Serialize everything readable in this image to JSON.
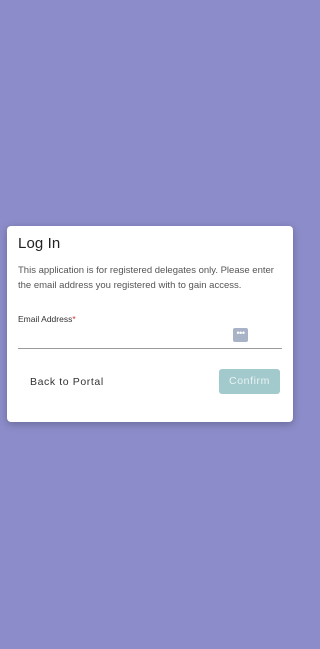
{
  "dialog": {
    "title": "Log In",
    "message": "This application is for registered delegates only. Please enter the email address you registered with to gain access.",
    "email_field": {
      "label": "Email Address",
      "required_marker": "*",
      "value": "",
      "placeholder": ""
    },
    "password_manager_icon": "key-dots-icon",
    "back_label": "Back to Portal",
    "confirm_label": "Confirm",
    "confirm_disabled": true
  },
  "colors": {
    "background": "#8b8cc9",
    "confirm_button": "#a2c9cc",
    "required_marker": "#d32f2f"
  }
}
